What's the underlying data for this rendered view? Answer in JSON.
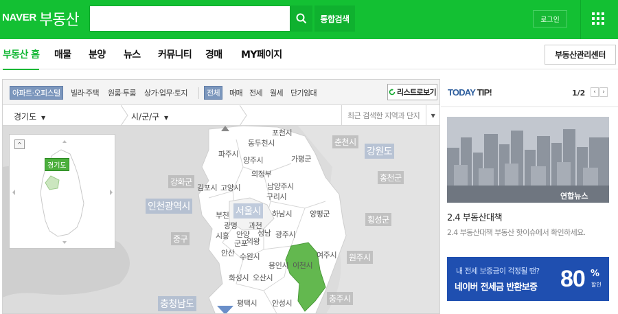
{
  "header": {
    "logo_naver": "NAVER",
    "logo_service": "부동산",
    "search_value": "",
    "search_icon": "search-icon",
    "total_search_label": "통합검색",
    "login_label": "로그인",
    "apps_icon": "grid-icon"
  },
  "nav": {
    "items": [
      {
        "label": "부동산 홈",
        "active": true
      },
      {
        "label": "매물"
      },
      {
        "label": "분양"
      },
      {
        "label": "뉴스"
      },
      {
        "label": "커뮤니티"
      },
      {
        "label": "경매"
      },
      {
        "label": "MY페이지"
      }
    ],
    "center_label": "부동산관리센터"
  },
  "filters": {
    "property_types": [
      "아파트·오피스텔",
      "빌라·주택",
      "원룸·투룸",
      "상가·업무·토지"
    ],
    "trade_types": [
      "전체",
      "매매",
      "전세",
      "월세",
      "단기임대"
    ],
    "list_view_label": "리스트로보기"
  },
  "location": {
    "province": "경기도",
    "district": "시/군/구",
    "recent_placeholder": "최근 검색한 지역과 단지"
  },
  "map": {
    "minimap_toggle": "^",
    "minimap_label": "경기도",
    "cities": {
      "pocheon": "포천시",
      "dongducheon": "동두천시",
      "paju": "파주시",
      "yangju": "양주시",
      "gapyeong": "가평군",
      "uijeongbu": "의정부",
      "namyangju": "남양주시",
      "guri": "구리시",
      "gimpo": "김포시",
      "goyang": "고양시",
      "bucheon": "부천",
      "hanam": "하남시",
      "yangpyeong": "양평군",
      "gwangmyeong": "광명",
      "gwacheon": "과천",
      "seongnam": "성남",
      "siheung": "시흥",
      "anyang": "안양",
      "uiwang": "의왕",
      "gunpo": "군포",
      "gwangju": "광주시",
      "ansan": "안산",
      "suwon": "수원시",
      "yongin": "용인시",
      "icheon": "이천시",
      "yeoju": "여주시",
      "hwaseong": "화성시",
      "osan": "오산시",
      "pyeongtaek": "평택시",
      "anseong": "안성시"
    },
    "regions": {
      "chuncheon": "춘천시",
      "gangwon": "강원도",
      "hongcheon": "홍천군",
      "ganghwa": "강화군",
      "incheon": "인천광역시",
      "seoul": "서울시",
      "hoengseong": "횡성군",
      "junggu": "중구",
      "wonju": "원주시",
      "chungnam": "충청남도",
      "chungju": "충주시"
    }
  },
  "tip": {
    "title_prefix": "TODAY",
    "title_suffix": "TIP!",
    "page": "1/2",
    "prev": "‹",
    "next": "›",
    "image_credit": "연합뉴스",
    "headline": "2.4 부동산대책",
    "subtitle": "2.4 부동산대책 부동산 핫이슈에서 확인하세요.",
    "banner_line1": "내 전세 보증금이 걱정될 땐?",
    "banner_line2": "네이버 전세금 반환보증",
    "banner_pct": "80",
    "banner_unit": "%",
    "banner_small": "할인"
  },
  "colors": {
    "brand_green": "#13c033",
    "active_region_green": "#63b84f",
    "filter_selected": "#7c97bd",
    "banner_blue": "#1f4fb0"
  }
}
